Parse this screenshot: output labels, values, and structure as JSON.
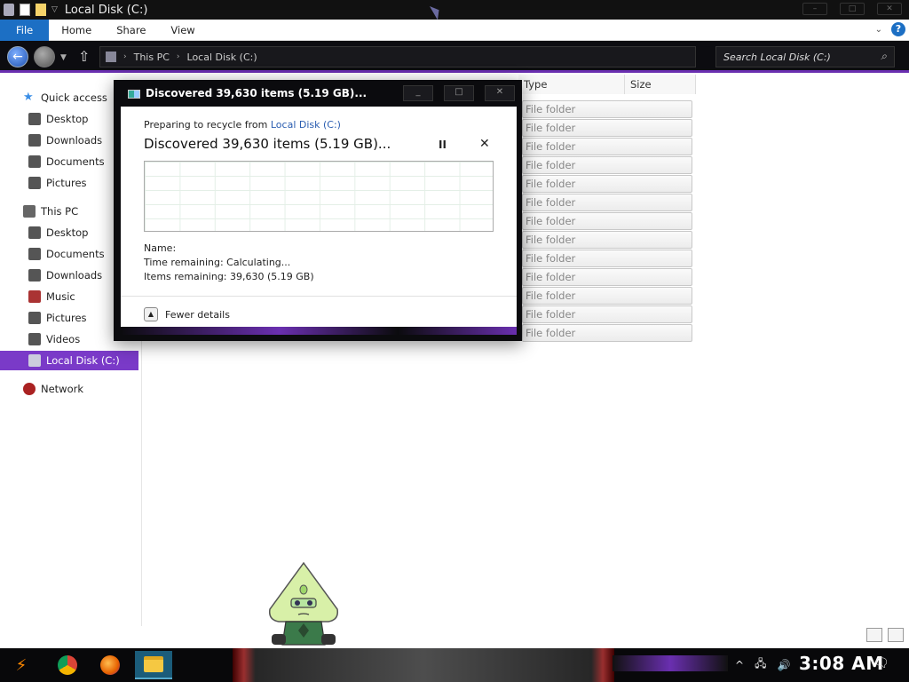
{
  "window": {
    "title": "Local Disk (C:)",
    "controls": [
      "–",
      "□",
      "✕"
    ]
  },
  "ribbon": {
    "tabs": [
      "File",
      "Home",
      "Share",
      "View"
    ],
    "help": "?"
  },
  "address": {
    "crumbs": [
      "This PC",
      "Local Disk (C:)"
    ],
    "search_placeholder": "Search Local Disk (C:)"
  },
  "sidebar": {
    "items": [
      {
        "label": "Quick access",
        "color": "#3a8ee6"
      },
      {
        "label": "Desktop",
        "color": "#444"
      },
      {
        "label": "Downloads",
        "color": "#444"
      },
      {
        "label": "Documents",
        "color": "#444"
      },
      {
        "label": "Pictures",
        "color": "#444"
      },
      {
        "label": "This PC",
        "color": "#555"
      },
      {
        "label": "Desktop",
        "color": "#444"
      },
      {
        "label": "Documents",
        "color": "#444"
      },
      {
        "label": "Downloads",
        "color": "#444"
      },
      {
        "label": "Music",
        "color": "#a33"
      },
      {
        "label": "Pictures",
        "color": "#444"
      },
      {
        "label": "Videos",
        "color": "#444"
      },
      {
        "label": "Local Disk (C:)",
        "color": "#333"
      },
      {
        "label": "Network",
        "color": "#a22"
      }
    ]
  },
  "filelist": {
    "columns": [
      "Type",
      "Size"
    ],
    "rows": [
      "File folder",
      "File folder",
      "File folder",
      "File folder",
      "File folder",
      "File folder",
      "File folder",
      "File folder",
      "File folder",
      "File folder",
      "File folder",
      "File folder",
      "File folder"
    ]
  },
  "dialog": {
    "title": "Discovered 39,630 items (5.19 GB)...",
    "prep_prefix": "Preparing to recycle from ",
    "prep_link": "Local Disk (C:)",
    "headline": "Discovered 39,630 items (5.19 GB)...",
    "pause": "II",
    "cancel": "✕",
    "name_label": "Name:",
    "time_remaining": "Time remaining:  Calculating...",
    "items_remaining": "Items remaining:  39,630 (5.19 GB)",
    "fewer_details": "Fewer details",
    "controls": [
      "_",
      "□",
      "✕"
    ]
  },
  "taskbar": {
    "clock": "3:08 AM",
    "apps": [
      "start",
      "chrome",
      "firefox",
      "file-explorer"
    ],
    "accent": "#6a2fb0"
  }
}
